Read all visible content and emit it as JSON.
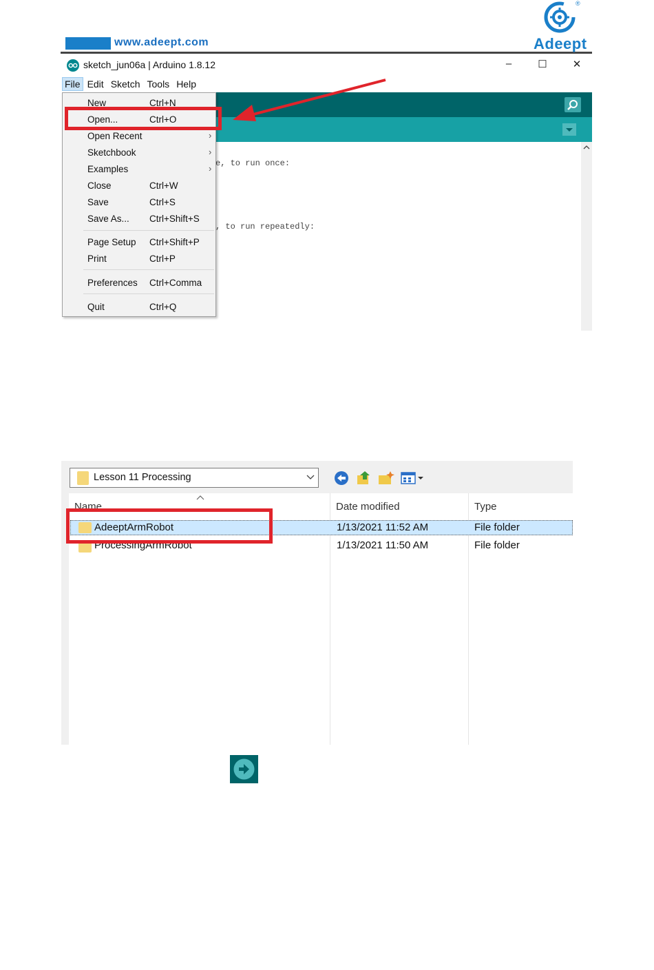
{
  "header": {
    "url": "www.adeept.com",
    "brand": "Adeept",
    "reg_mark": "®"
  },
  "arduino": {
    "window_title": "sketch_jun06a | Arduino 1.8.12",
    "window_controls": [
      "–",
      "☐",
      "✕"
    ],
    "menubar": [
      "File",
      "Edit",
      "Sketch",
      "Tools",
      "Help"
    ],
    "active_menu": "File",
    "code_lines": [
      "e, to run once:",
      ", to run repeatedly:"
    ],
    "file_menu": [
      {
        "label": "New",
        "shortcut": "Ctrl+N"
      },
      {
        "label": "Open...",
        "shortcut": "Ctrl+O"
      },
      {
        "label": "Open Recent",
        "shortcut": "",
        "submenu": true
      },
      {
        "label": "Sketchbook",
        "shortcut": "",
        "submenu": true
      },
      {
        "label": "Examples",
        "shortcut": "",
        "submenu": true
      },
      {
        "label": "Close",
        "shortcut": "Ctrl+W"
      },
      {
        "label": "Save",
        "shortcut": "Ctrl+S"
      },
      {
        "label": "Save As...",
        "shortcut": "Ctrl+Shift+S"
      },
      {
        "label": "Page Setup",
        "shortcut": "Ctrl+Shift+P"
      },
      {
        "label": "Print",
        "shortcut": "Ctrl+P"
      },
      {
        "label": "Preferences",
        "shortcut": "Ctrl+Comma"
      },
      {
        "label": "Quit",
        "shortcut": "Ctrl+Q"
      }
    ],
    "submenu_arrow": "›"
  },
  "file_dialog": {
    "current_folder": "Lesson 11 Processing",
    "columns": [
      "Name",
      "Date modified",
      "Type"
    ],
    "rows": [
      {
        "name": "AdeeptArmRobot",
        "date": "1/13/2021 11:52 AM",
        "type": "File folder"
      },
      {
        "name": "ProcessingArmRobot",
        "date": "1/13/2021 11:50 AM",
        "type": "File folder"
      }
    ]
  },
  "colors": {
    "highlight_red": "#e0242b",
    "arduino_teal_dark": "#006468",
    "arduino_teal": "#17a1a5",
    "brand_blue": "#1a7fc9"
  }
}
